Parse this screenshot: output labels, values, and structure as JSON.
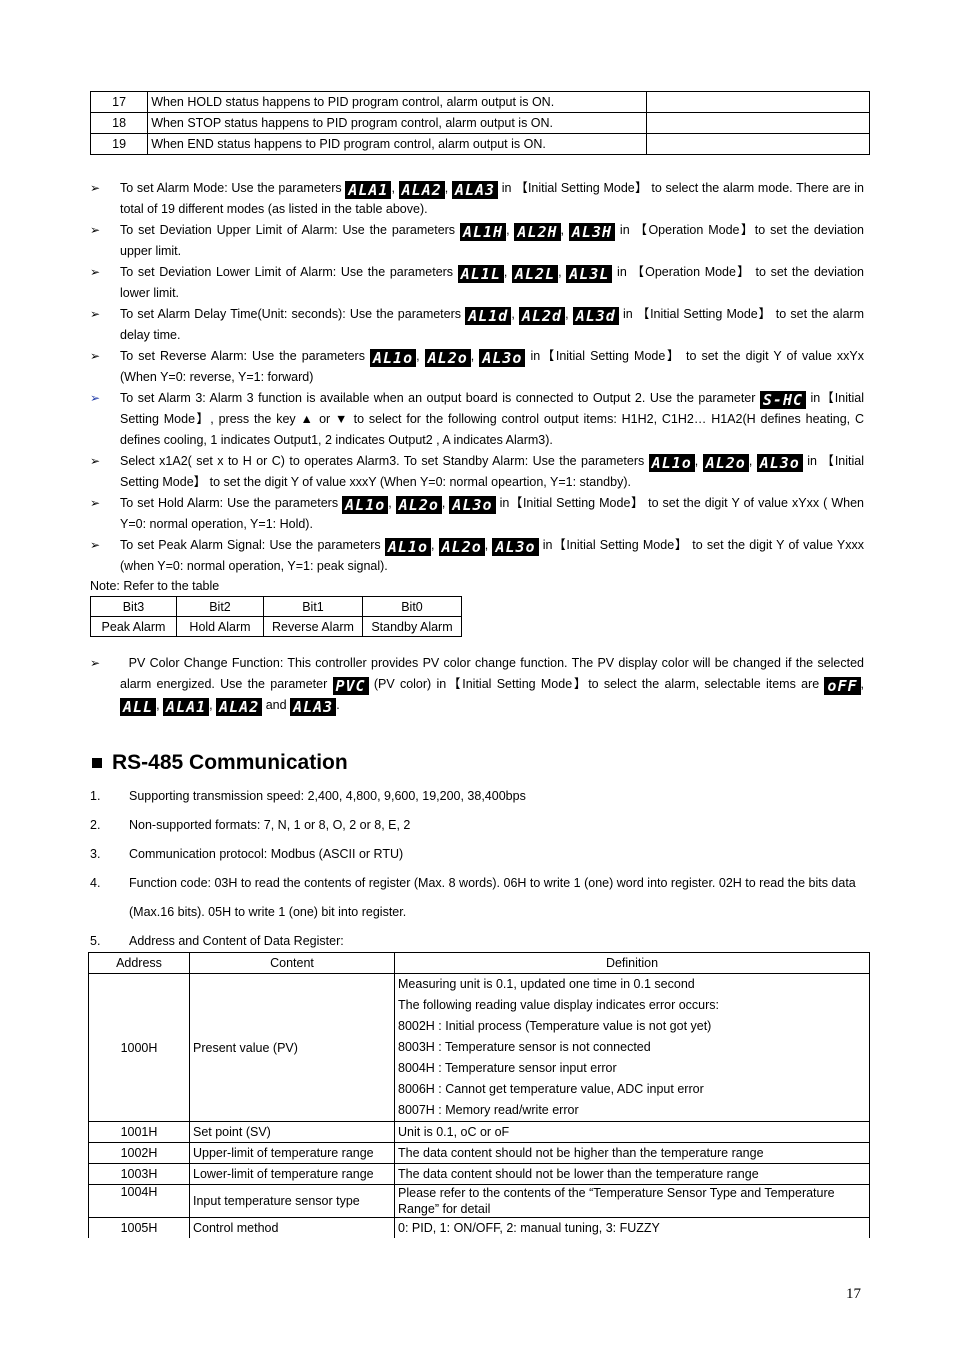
{
  "alarm_mode_table": {
    "rows": [
      {
        "num": "17",
        "desc": "When HOLD status happens to PID program control, alarm output is ON.",
        "extra": ""
      },
      {
        "num": "18",
        "desc": "When STOP status happens to PID program control, alarm output is ON.",
        "extra": ""
      },
      {
        "num": "19",
        "desc": "When END status happens to PID program control, alarm output is ON.",
        "extra": ""
      }
    ]
  },
  "bullets": {
    "b1": {
      "pre": "To set Alarm Mode: Use the parameters ",
      "codes": [
        "ALA1",
        "ALA2",
        "ALA3"
      ],
      "post": " in 【Initial Setting Mode】 to select the alarm mode. There are in total of 19 different modes (as listed in the table above)."
    },
    "b2": {
      "pre": "To set Deviation Upper Limit of Alarm: Use the parameters ",
      "codes": [
        "AL1H",
        "AL2H",
        "AL3H"
      ],
      "post": " in 【Operation Mode】to set the deviation upper limit."
    },
    "b3": {
      "pre": "To set Deviation Lower Limit of Alarm: Use the parameters ",
      "codes": [
        "AL1L",
        "AL2L",
        "AL3L"
      ],
      "post": " in 【Operation Mode】 to set the deviation lower limit."
    },
    "b4": {
      "pre": "To set Alarm Delay Time(Unit: seconds): Use the parameters ",
      "codes": [
        "AL1d",
        "AL2d",
        "AL3d"
      ],
      "post": " in 【Initial Setting Mode】 to set the alarm delay time."
    },
    "b5": {
      "pre": "To set Reverse Alarm: Use the parameters ",
      "codes": [
        "AL1o",
        "AL2o",
        "AL3o"
      ],
      "post": " in【Initial Setting Mode】 to set the digit Y of value xxYx (When Y=0: reverse, Y=1: forward)"
    },
    "b6": {
      "pre": "To set Alarm 3: Alarm 3 function is available when an output board is connected to Output 2. Use the parameter ",
      "codes": [
        "S-HC"
      ],
      "post": " in【Initial Setting Mode】, press the key ▲ or ▼ to select for the following control output items: H1H2, C1H2… H1A2(H defines heating, C defines cooling, 1 indicates Output1, 2 indicates Output2 , A indicates Alarm3)."
    },
    "b7": {
      "pre": "Select x1A2( set x to H or C) to operates Alarm3. To set Standby Alarm: Use the parameters ",
      "codes": [
        "AL1o",
        "AL2o",
        "AL3o"
      ],
      "post": " in 【Initial Setting Mode】 to set the digit Y of value xxxY (When Y=0: normal opeartion, Y=1: standby)."
    },
    "b8": {
      "pre": "To set Hold Alarm: Use the parameters ",
      "codes": [
        "AL1o",
        "AL2o",
        "AL3o"
      ],
      "post": " in【Initial Setting Mode】 to set the digit Y of value xYxx ( When Y=0: normal operation, Y=1: Hold)."
    },
    "b9": {
      "pre": "To set Peak Alarm Signal: Use the parameters ",
      "codes": [
        "AL1o",
        "AL2o",
        "AL3o"
      ],
      "post": " in【Initial Setting Mode】 to set the digit Y of value Yxxx (when Y=0: normal operation, Y=1: peak signal)."
    }
  },
  "note": "Note: Refer to the table",
  "bits_table": {
    "headers": [
      "Bit3",
      "Bit2",
      "Bit1",
      "Bit0"
    ],
    "values": [
      "Peak Alarm",
      "Hold Alarm",
      "Reverse Alarm",
      "Standby Alarm"
    ]
  },
  "pv_color": {
    "pre": "PV Color Change Function: This controller provides PV color change function. The PV display color will be changed if the selected alarm energized. Use the parameter ",
    "param": "PVC",
    "mid": " (PV color) in【Initial Setting Mode】to select the alarm, selectable items are ",
    "options": [
      "oFF",
      "ALL",
      "ALA1",
      "ALA2",
      "ALA3"
    ],
    "and": "and"
  },
  "section": {
    "title": "RS-485 Communication",
    "items": [
      {
        "n": "1.",
        "text": "Supporting transmission speed: 2,400, 4,800, 9,600, 19,200, 38,400bps"
      },
      {
        "n": "2.",
        "text": "Non-supported formats: 7, N, 1 or 8, O, 2 or 8, E, 2"
      },
      {
        "n": "3.",
        "text": "Communication protocol: Modbus (ASCII or RTU)"
      },
      {
        "n": "4.",
        "text": "Function code: 03H to read the contents of register (Max. 8 words). 06H to write 1 (one) word into register. 02H to read the bits data (Max.16 bits). 05H to write 1 (one) bit into register."
      },
      {
        "n": "5.",
        "text": "Address and Content of Data Register:"
      }
    ]
  },
  "register_table": {
    "headers": [
      "Address",
      "Content",
      "Definition"
    ],
    "rows": [
      {
        "address": "1000H",
        "content": "Present value (PV)",
        "definition": [
          "Measuring unit is 0.1, updated one time in 0.1 second",
          "The following reading value display indicates error occurs:",
          "8002H : Initial process (Temperature value is not got yet)",
          "8003H : Temperature sensor is not connected",
          "8004H : Temperature sensor input error",
          "8006H : Cannot get temperature value, ADC input error",
          "8007H : Memory read/write error"
        ]
      },
      {
        "address": "1001H",
        "content": "Set point (SV)",
        "definition": [
          "Unit is 0.1, oC or oF"
        ]
      },
      {
        "address": "1002H",
        "content": "Upper-limit of temperature range",
        "definition": [
          "The data content should not be higher than the temperature range"
        ]
      },
      {
        "address": "1003H",
        "content": "Lower-limit of temperature range",
        "definition": [
          "The data content should not be lower than the temperature range"
        ]
      },
      {
        "address": "1004H",
        "content": "Input temperature sensor type",
        "definition": [
          "Please refer to the contents of the “Temperature Sensor Type and Temperature Range” for detail"
        ]
      },
      {
        "address": "1005H",
        "content": "Control method",
        "definition": [
          "0: PID, 1: ON/OFF, 2: manual tuning, 3: FUZZY"
        ]
      }
    ]
  },
  "page_number": "17"
}
